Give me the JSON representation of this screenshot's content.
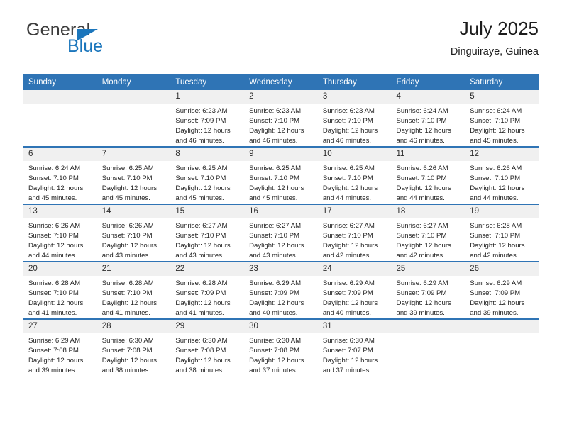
{
  "brand": {
    "name_top": "General",
    "name_bottom": "Blue",
    "triangle_icon": "blue-triangle-logo-mark"
  },
  "header": {
    "title": "July 2025",
    "subtitle": "Dinguiraye, Guinea"
  },
  "colors": {
    "header_blue": "#2f74b5",
    "brand_blue": "#1b76bc",
    "daynum_band": "#f0f0f0",
    "text": "#232323"
  },
  "calendar": {
    "weekday_headers": [
      "Sunday",
      "Monday",
      "Tuesday",
      "Wednesday",
      "Thursday",
      "Friday",
      "Saturday"
    ],
    "labels": {
      "sunrise": "Sunrise:",
      "sunset": "Sunset:",
      "daylight": "Daylight:"
    },
    "weeks": [
      [
        {
          "day": ""
        },
        {
          "day": ""
        },
        {
          "day": "1",
          "sunrise": "Sunrise: 6:23 AM",
          "sunset": "Sunset: 7:09 PM",
          "daylight": "Daylight: 12 hours and 46 minutes."
        },
        {
          "day": "2",
          "sunrise": "Sunrise: 6:23 AM",
          "sunset": "Sunset: 7:10 PM",
          "daylight": "Daylight: 12 hours and 46 minutes."
        },
        {
          "day": "3",
          "sunrise": "Sunrise: 6:23 AM",
          "sunset": "Sunset: 7:10 PM",
          "daylight": "Daylight: 12 hours and 46 minutes."
        },
        {
          "day": "4",
          "sunrise": "Sunrise: 6:24 AM",
          "sunset": "Sunset: 7:10 PM",
          "daylight": "Daylight: 12 hours and 46 minutes."
        },
        {
          "day": "5",
          "sunrise": "Sunrise: 6:24 AM",
          "sunset": "Sunset: 7:10 PM",
          "daylight": "Daylight: 12 hours and 45 minutes."
        }
      ],
      [
        {
          "day": "6",
          "sunrise": "Sunrise: 6:24 AM",
          "sunset": "Sunset: 7:10 PM",
          "daylight": "Daylight: 12 hours and 45 minutes."
        },
        {
          "day": "7",
          "sunrise": "Sunrise: 6:25 AM",
          "sunset": "Sunset: 7:10 PM",
          "daylight": "Daylight: 12 hours and 45 minutes."
        },
        {
          "day": "8",
          "sunrise": "Sunrise: 6:25 AM",
          "sunset": "Sunset: 7:10 PM",
          "daylight": "Daylight: 12 hours and 45 minutes."
        },
        {
          "day": "9",
          "sunrise": "Sunrise: 6:25 AM",
          "sunset": "Sunset: 7:10 PM",
          "daylight": "Daylight: 12 hours and 45 minutes."
        },
        {
          "day": "10",
          "sunrise": "Sunrise: 6:25 AM",
          "sunset": "Sunset: 7:10 PM",
          "daylight": "Daylight: 12 hours and 44 minutes."
        },
        {
          "day": "11",
          "sunrise": "Sunrise: 6:26 AM",
          "sunset": "Sunset: 7:10 PM",
          "daylight": "Daylight: 12 hours and 44 minutes."
        },
        {
          "day": "12",
          "sunrise": "Sunrise: 6:26 AM",
          "sunset": "Sunset: 7:10 PM",
          "daylight": "Daylight: 12 hours and 44 minutes."
        }
      ],
      [
        {
          "day": "13",
          "sunrise": "Sunrise: 6:26 AM",
          "sunset": "Sunset: 7:10 PM",
          "daylight": "Daylight: 12 hours and 44 minutes."
        },
        {
          "day": "14",
          "sunrise": "Sunrise: 6:26 AM",
          "sunset": "Sunset: 7:10 PM",
          "daylight": "Daylight: 12 hours and 43 minutes."
        },
        {
          "day": "15",
          "sunrise": "Sunrise: 6:27 AM",
          "sunset": "Sunset: 7:10 PM",
          "daylight": "Daylight: 12 hours and 43 minutes."
        },
        {
          "day": "16",
          "sunrise": "Sunrise: 6:27 AM",
          "sunset": "Sunset: 7:10 PM",
          "daylight": "Daylight: 12 hours and 43 minutes."
        },
        {
          "day": "17",
          "sunrise": "Sunrise: 6:27 AM",
          "sunset": "Sunset: 7:10 PM",
          "daylight": "Daylight: 12 hours and 42 minutes."
        },
        {
          "day": "18",
          "sunrise": "Sunrise: 6:27 AM",
          "sunset": "Sunset: 7:10 PM",
          "daylight": "Daylight: 12 hours and 42 minutes."
        },
        {
          "day": "19",
          "sunrise": "Sunrise: 6:28 AM",
          "sunset": "Sunset: 7:10 PM",
          "daylight": "Daylight: 12 hours and 42 minutes."
        }
      ],
      [
        {
          "day": "20",
          "sunrise": "Sunrise: 6:28 AM",
          "sunset": "Sunset: 7:10 PM",
          "daylight": "Daylight: 12 hours and 41 minutes."
        },
        {
          "day": "21",
          "sunrise": "Sunrise: 6:28 AM",
          "sunset": "Sunset: 7:10 PM",
          "daylight": "Daylight: 12 hours and 41 minutes."
        },
        {
          "day": "22",
          "sunrise": "Sunrise: 6:28 AM",
          "sunset": "Sunset: 7:09 PM",
          "daylight": "Daylight: 12 hours and 41 minutes."
        },
        {
          "day": "23",
          "sunrise": "Sunrise: 6:29 AM",
          "sunset": "Sunset: 7:09 PM",
          "daylight": "Daylight: 12 hours and 40 minutes."
        },
        {
          "day": "24",
          "sunrise": "Sunrise: 6:29 AM",
          "sunset": "Sunset: 7:09 PM",
          "daylight": "Daylight: 12 hours and 40 minutes."
        },
        {
          "day": "25",
          "sunrise": "Sunrise: 6:29 AM",
          "sunset": "Sunset: 7:09 PM",
          "daylight": "Daylight: 12 hours and 39 minutes."
        },
        {
          "day": "26",
          "sunrise": "Sunrise: 6:29 AM",
          "sunset": "Sunset: 7:09 PM",
          "daylight": "Daylight: 12 hours and 39 minutes."
        }
      ],
      [
        {
          "day": "27",
          "sunrise": "Sunrise: 6:29 AM",
          "sunset": "Sunset: 7:08 PM",
          "daylight": "Daylight: 12 hours and 39 minutes."
        },
        {
          "day": "28",
          "sunrise": "Sunrise: 6:30 AM",
          "sunset": "Sunset: 7:08 PM",
          "daylight": "Daylight: 12 hours and 38 minutes."
        },
        {
          "day": "29",
          "sunrise": "Sunrise: 6:30 AM",
          "sunset": "Sunset: 7:08 PM",
          "daylight": "Daylight: 12 hours and 38 minutes."
        },
        {
          "day": "30",
          "sunrise": "Sunrise: 6:30 AM",
          "sunset": "Sunset: 7:08 PM",
          "daylight": "Daylight: 12 hours and 37 minutes."
        },
        {
          "day": "31",
          "sunrise": "Sunrise: 6:30 AM",
          "sunset": "Sunset: 7:07 PM",
          "daylight": "Daylight: 12 hours and 37 minutes."
        },
        {
          "day": ""
        },
        {
          "day": ""
        }
      ]
    ]
  }
}
